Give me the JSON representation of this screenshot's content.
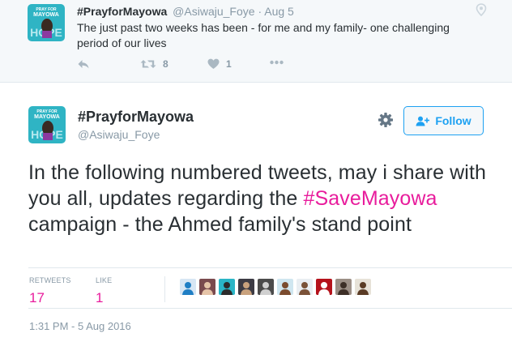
{
  "parent_tweet": {
    "name": "#PrayforMayowa",
    "handle": "@Asiwaju_Foye",
    "separator": "·",
    "date": "Aug 5",
    "text": "The just past two weeks has been - for me and my family- one challenging period of our lives",
    "retweet_count": "8",
    "like_count": "1"
  },
  "main_tweet": {
    "name": "#PrayforMayowa",
    "handle": "@Asiwaju_Foye",
    "follow_label": "Follow",
    "text_before": "In the following numbered tweets, may i share with you all, updates regarding the ",
    "hashtag": "#SaveMayowa",
    "text_after": " campaign - the Ahmed family's stand point",
    "stats": {
      "retweets_label": "RETWEETS",
      "retweets": "17",
      "likes_label": "LIKE",
      "likes": "1"
    },
    "timestamp": "1:31 PM - 5 Aug 2016"
  },
  "avatar_art": {
    "line1": "PRAY FOR",
    "line2": "MAYOWA",
    "line3": "HOPE"
  },
  "likers": [
    {
      "icon": "liker-avatar-1",
      "bg": "#d7e6f4",
      "fg": "#1f7ec4"
    },
    {
      "icon": "liker-avatar-2",
      "bg": "#7a4a4e",
      "fg": "#e6c4a8"
    },
    {
      "icon": "liker-avatar-3",
      "bg": "#2ab5c6",
      "fg": "#2b2b2b"
    },
    {
      "icon": "liker-avatar-4",
      "bg": "#3c3b44",
      "fg": "#c9a27d"
    },
    {
      "icon": "liker-avatar-5",
      "bg": "#4b4b4b",
      "fg": "#d0d0d0"
    },
    {
      "icon": "liker-avatar-6",
      "bg": "#cfe6f0",
      "fg": "#7a4b2e"
    },
    {
      "icon": "liker-avatar-7",
      "bg": "#e9eef2",
      "fg": "#7a5238"
    },
    {
      "icon": "liker-avatar-8",
      "bg": "#b5121b",
      "fg": "#ffffff"
    },
    {
      "icon": "liker-avatar-9",
      "bg": "#9c8f86",
      "fg": "#3d2f27"
    },
    {
      "icon": "liker-avatar-10",
      "bg": "#e7e2d8",
      "fg": "#5a3b25"
    }
  ],
  "colors": {
    "accent": "#1da1f2",
    "hashtag": "#e81c9c",
    "muted": "#8899a6",
    "text": "#292f33"
  }
}
